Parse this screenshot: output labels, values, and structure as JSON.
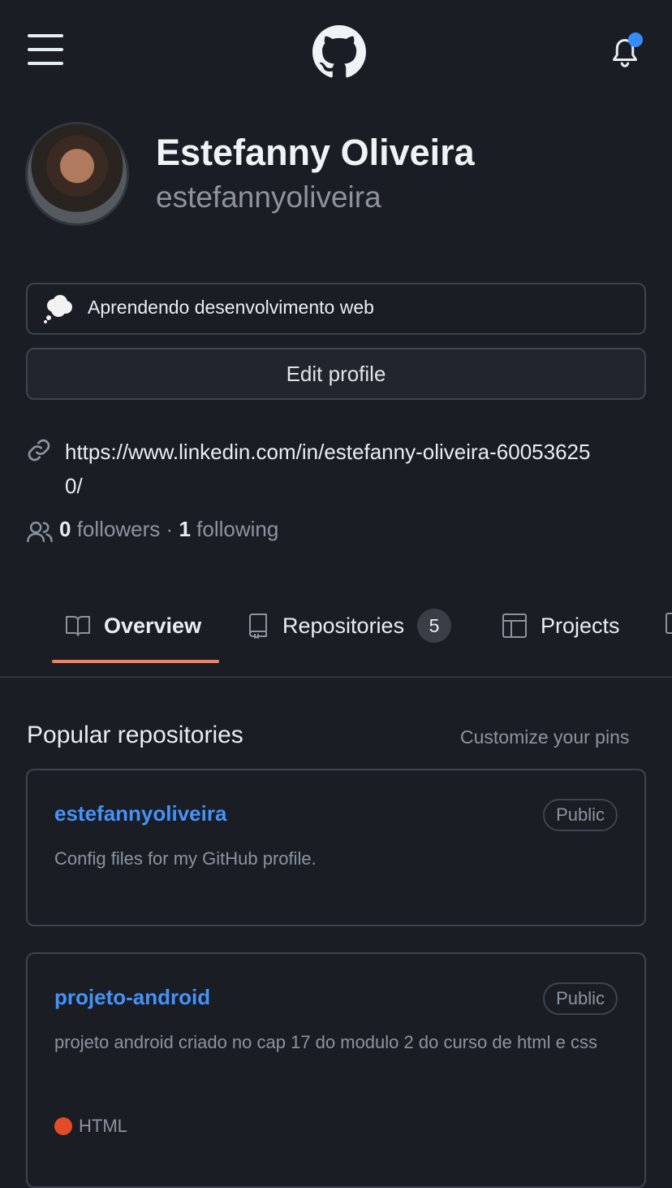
{
  "header": {
    "menu_icon": "hamburger-menu-icon",
    "logo_icon": "github-octocat-icon",
    "notifications_icon": "bell-icon"
  },
  "profile": {
    "display_name": "Estefanny Oliveira",
    "username": "estefannyoliveira",
    "status_emoji": "thought-balloon-icon",
    "status_text": "Aprendendo desenvolvimento web",
    "edit_label": "Edit profile",
    "link": "https://www.linkedin.com/in/estefanny-oliveira-600536250/",
    "followers_count": "0",
    "followers_label": "followers",
    "separator": "·",
    "following_count": "1",
    "following_label": "following"
  },
  "tabs": [
    {
      "label": "Overview",
      "icon": "book-icon",
      "active": true
    },
    {
      "label": "Repositories",
      "icon": "repo-icon",
      "count": "5"
    },
    {
      "label": "Projects",
      "icon": "table-icon"
    }
  ],
  "popular": {
    "title": "Popular repositories",
    "customize_label": "Customize your pins",
    "repos": [
      {
        "name": "estefannyoliveira",
        "visibility": "Public",
        "description": "Config files for my GitHub profile."
      },
      {
        "name": "projeto-android",
        "visibility": "Public",
        "description": "projeto android criado no cap 17 do modulo 2 do curso de html e css",
        "language": "HTML",
        "language_color": "#e34c26"
      }
    ]
  },
  "colors": {
    "background": "#1b1d25",
    "link": "#4493f8",
    "accent_underline": "#f78166",
    "notification_dot": "#388bfd"
  }
}
